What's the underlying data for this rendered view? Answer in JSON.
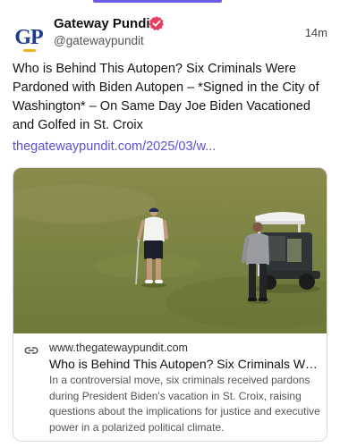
{
  "author": {
    "name": "Gateway Pundit",
    "handle": "@gatewaypundit",
    "avatar_text": "GP",
    "verified_badge_color": "#e83e62"
  },
  "post": {
    "timestamp": "14m",
    "text": "Who is Behind This Autopen? Six Criminals Were Pardoned with Biden Autopen – *Signed in the City of Washington* – On Same Day Joe Biden Vacationed and Golfed in St. Croix",
    "link_text": "thegatewaypundit.com/2025/03/w..."
  },
  "link_card": {
    "domain": "www.thegatewaypundit.com",
    "title": "Who is Behind This Autopen? Six Criminals We...",
    "description": "In a controversial move, six criminals received pardons during President Biden's vacation in St. Croix, raising questions about the implications for justice and executive power in a polarized political climate.",
    "icon": "link-icon",
    "image": "photo-golfer-and-golf-cart"
  },
  "colors": {
    "accent": "#5b4fd8",
    "indicator": "#6a5ce6"
  }
}
